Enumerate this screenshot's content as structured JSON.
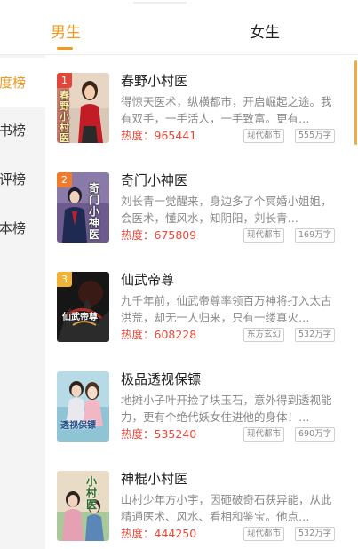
{
  "tabs": {
    "male": "男生",
    "female": "女生"
  },
  "sidebar": {
    "items": [
      {
        "label": "度榜",
        "active": true
      },
      {
        "label": "书榜",
        "active": false
      },
      {
        "label": "评榜",
        "active": false
      },
      {
        "label": "本榜",
        "active": false
      }
    ]
  },
  "colors": {
    "accent": "#f09a1f",
    "hot": "#e8483a"
  },
  "books": [
    {
      "rank": "1",
      "title": "春野小村医",
      "cover_text": "春野小村医",
      "description": "得惊天医术，纵横都市，开启崛起之途。我有双手，一手活人，一手致富。更有…",
      "hot": "热度：965441",
      "genre": "现代都市",
      "words": "555万字"
    },
    {
      "rank": "2",
      "title": "奇门小神医",
      "cover_text": "奇门小神医",
      "description": "刘长青一觉醒来，身边多了个冥婚小姐姐，会医术，懂风水，知阴阳，刘长青…",
      "hot": "热度：675809",
      "genre": "现代都市",
      "words": "169万字"
    },
    {
      "rank": "3",
      "title": "仙武帝尊",
      "cover_text": "仙武帝尊",
      "description": "九千年前，仙武帝尊率领百万神将打入太古洪荒，却无一人归来，只有一缕真火…",
      "hot": "热度：608228",
      "genre": "东方玄幻",
      "words": "532万字"
    },
    {
      "title": "极品透视保镖",
      "cover_text": "透视保镖",
      "description": "地摊小子叶开捡了块玉石，意外得到透视能力，更有个绝代妖女住进他的身体！…",
      "hot": "热度：535240",
      "genre": "现代都市",
      "words": "690万字"
    },
    {
      "title": "神棍小村医",
      "cover_text": "小村医",
      "description": "山村少年方小宇，因砸破奇石获异能，从此精通医术、风水、看相和鉴宝。他点…",
      "hot": "热度：444250",
      "genre": "现代都市",
      "words": "532万字"
    }
  ]
}
